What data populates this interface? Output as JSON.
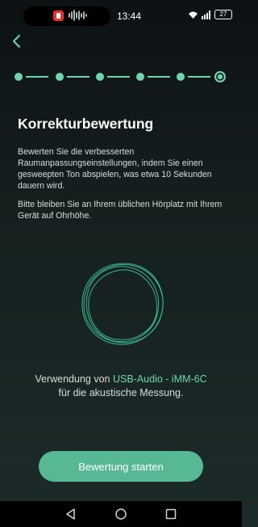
{
  "status_bar": {
    "time": "13:44",
    "battery": "27",
    "icons": [
      "app-notification-icon",
      "audio-wave-icon",
      "wifi-icon",
      "signal-icon",
      "battery-icon"
    ]
  },
  "header": {
    "back_icon": "chevron-left-icon"
  },
  "stepper": {
    "total_steps": 6,
    "current_step": 6,
    "color": "#6fd4b0"
  },
  "main": {
    "title": "Korrekturbewertung",
    "description": "Bewerten Sie die verbesserten Raumanpassungseinstellungen, indem Sie einen gesweepten Ton abspielen, was etwa 10 Sekunden dauern wird.",
    "instruction": "Bitte bleiben Sie an Ihrem üblichen Hörplatz mit Ihrem Gerät auf Ohrhöhe.",
    "measurement_prefix": "Verwendung von",
    "device_name": "USB-Audio - iMM-6C",
    "measurement_suffix": "für die akustische Messung.",
    "accent_color": "#6fd4b0"
  },
  "actions": {
    "start_label": "Bewertung starten",
    "button_color": "#57b894"
  },
  "navigation": {
    "items": [
      "back-triangle-icon",
      "home-circle-icon",
      "recents-square-icon"
    ]
  }
}
